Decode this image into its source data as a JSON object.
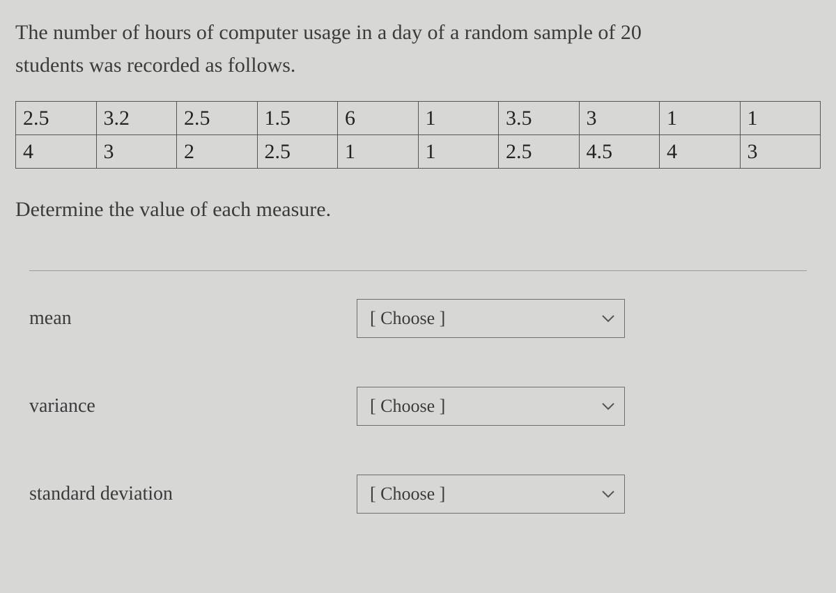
{
  "prompt_line1": "The number of hours of computer usage in a day of a random sample of 20",
  "prompt_line2": "students was recorded as follows.",
  "data_table": {
    "row1": [
      "2.5",
      "3.2",
      "2.5",
      "1.5",
      "6",
      "1",
      "3.5",
      "3",
      "1",
      "1"
    ],
    "row2": [
      "4",
      "3",
      "2",
      "2.5",
      "1",
      "1",
      "2.5",
      "4.5",
      "4",
      "3"
    ]
  },
  "instruction": "Determine the value of each measure.",
  "measures": [
    {
      "label": "mean",
      "placeholder": "[ Choose ]"
    },
    {
      "label": "variance",
      "placeholder": "[ Choose ]"
    },
    {
      "label": "standard deviation",
      "placeholder": "[ Choose ]"
    }
  ]
}
